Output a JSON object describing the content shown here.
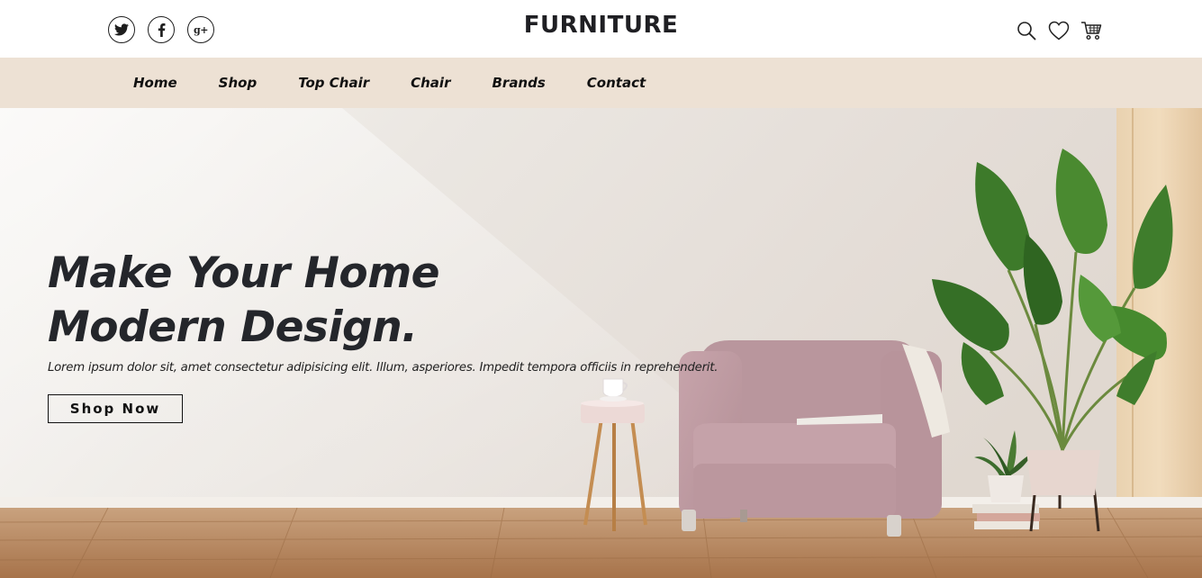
{
  "header": {
    "brand": "FURNITURE",
    "social": [
      {
        "name": "twitter",
        "icon": "twitter-icon"
      },
      {
        "name": "facebook",
        "icon": "facebook-icon",
        "glyph": "f"
      },
      {
        "name": "google-plus",
        "icon": "google-plus-icon",
        "glyph": "g+"
      }
    ],
    "utilities": [
      "search-icon",
      "heart-icon",
      "cart-icon"
    ]
  },
  "nav": {
    "items": [
      "Home",
      "Shop",
      "Top Chair",
      "Chair",
      "Brands",
      "Contact"
    ]
  },
  "hero": {
    "title_line1": "Make Your Home",
    "title_line2": "Modern Design.",
    "description": "Lorem ipsum dolor sit, amet consectetur adipisicing elit. Illum, asperiores. Impedit tempora officiis in reprehenderit.",
    "cta_label": "Shop Now"
  },
  "colors": {
    "nav_background": "#ede1d4",
    "text_dark": "#24262b",
    "wall": "#ebe6e0",
    "floor": "#b88658",
    "armchair": "#c29ea5",
    "plant_leaf": "#3f7d2c"
  }
}
